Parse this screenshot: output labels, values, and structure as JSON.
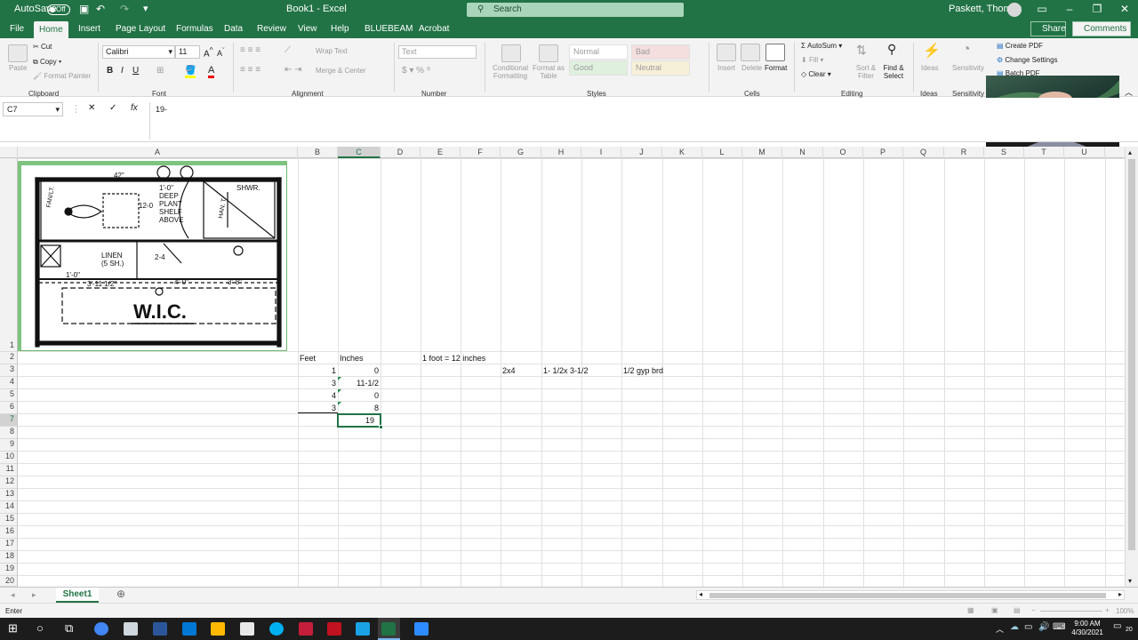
{
  "titlebar": {
    "autosave_label": "AutoSave",
    "autosave_state": "Off",
    "doc_title": "Book1 - Excel",
    "search_placeholder": "Search",
    "user_name": "Paskett, Thomas"
  },
  "menu": {
    "tabs": [
      "File",
      "Home",
      "Insert",
      "Page Layout",
      "Formulas",
      "Data",
      "Review",
      "View",
      "Help",
      "BLUEBEAM",
      "Acrobat"
    ],
    "active": "Home",
    "share_label": "Share",
    "comments_label": "Comments"
  },
  "ribbon": {
    "clipboard": {
      "paste": "Paste",
      "cut": "Cut",
      "copy": "Copy",
      "format_painter": "Format Painter",
      "group": "Clipboard"
    },
    "font": {
      "family": "Calibri",
      "size": "11",
      "group": "Font"
    },
    "alignment": {
      "wrap": "Wrap Text",
      "merge": "Merge & Center",
      "group": "Alignment"
    },
    "number": {
      "format": "Text",
      "group": "Number"
    },
    "styles": {
      "cond": "Conditional Formatting",
      "table": "Format as Table",
      "normal": "Normal",
      "bad": "Bad",
      "good": "Good",
      "neutral": "Neutral",
      "group": "Styles"
    },
    "cells": {
      "insert": "Insert",
      "delete": "Delete",
      "format": "Format",
      "group": "Cells"
    },
    "editing": {
      "autosum": "AutoSum",
      "fill": "Fill",
      "clear": "Clear",
      "sort": "Sort & Filter",
      "find": "Find & Select",
      "group": "Editing"
    },
    "ideas": {
      "label": "Ideas",
      "group": "Ideas"
    },
    "sensitivity": {
      "label": "Sensitivity",
      "group": "Sensitivity"
    },
    "acrobat": {
      "create": "Create PDF",
      "change": "Change Settings",
      "batch": "Batch PDF"
    }
  },
  "formula_bar": {
    "name_box": "C7",
    "formula": "19-"
  },
  "columns": [
    "A",
    "B",
    "C",
    "D",
    "E",
    "F",
    "G",
    "H",
    "I",
    "J",
    "K",
    "L",
    "M",
    "N",
    "O",
    "P",
    "Q",
    "R",
    "S",
    "T",
    "U"
  ],
  "rows": [
    "1",
    "2",
    "3",
    "4",
    "5",
    "6",
    "7",
    "8",
    "9",
    "10",
    "11",
    "12",
    "13",
    "14",
    "15",
    "16",
    "17",
    "18",
    "19",
    "20"
  ],
  "cells": {
    "B2": "Feet",
    "C2": "Inches",
    "E2": "1 foot = 12 inches",
    "B3": "1",
    "C3": "0",
    "G3": "2x4",
    "H3": "1- 1/2x 3-1/2",
    "J3": "1/2 gyp brd",
    "B4": "3",
    "C4": "11-1/2",
    "B5": "4",
    "C5": "0",
    "B6": "3",
    "C6": "8",
    "C7": "19"
  },
  "floorplan": {
    "labels": [
      "1'-0\"",
      "DEEP",
      "PLANT",
      "SHELF",
      "ABOVE",
      "SHWR.",
      "LINEN",
      "(5 SH.)",
      "2-4",
      "1'-0\"",
      "3'-11 1/2\"",
      "4'-0\"",
      "3'-8\"",
      "W.I.C.",
      "12-0",
      "42\"",
      "FAN/LT.",
      "HAN. T."
    ]
  },
  "sheet": {
    "tab": "Sheet1"
  },
  "status": {
    "mode": "Enter",
    "zoom": "100%"
  },
  "taskbar": {
    "time": "9:00 AM",
    "date": "4/30/2021",
    "notif": "20"
  }
}
